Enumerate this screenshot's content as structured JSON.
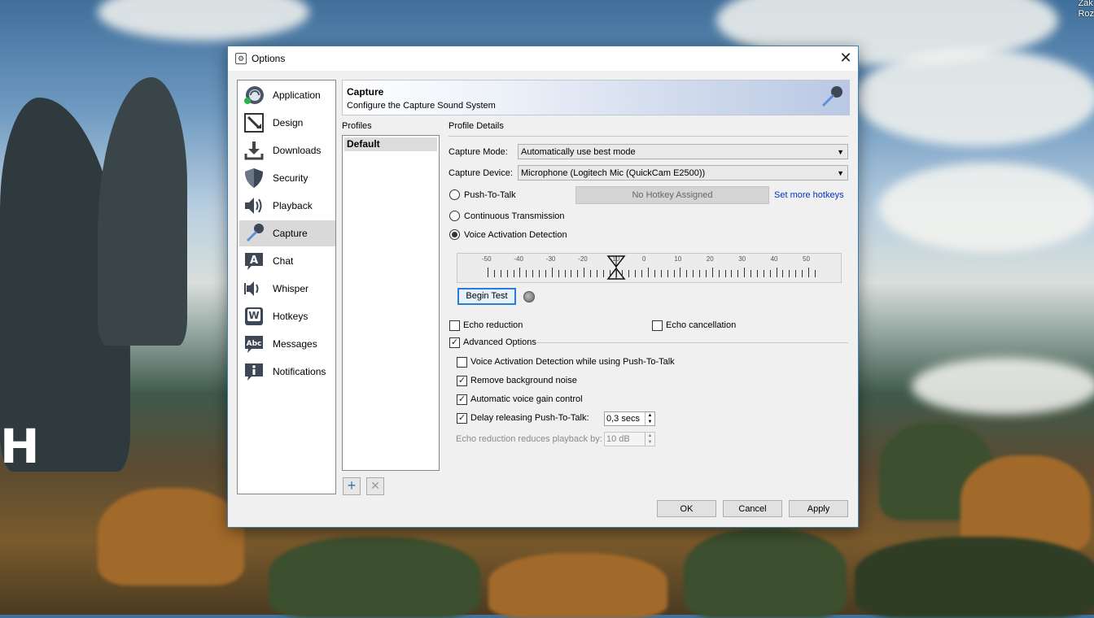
{
  "desktop": {
    "corner_text": [
      "Zak",
      "Roz"
    ],
    "left_glyph": "H"
  },
  "window": {
    "title": "Options",
    "close_glyph": "✕"
  },
  "nav": {
    "items": [
      {
        "label": "Application",
        "icon": "teamspeak-logo-icon"
      },
      {
        "label": "Design",
        "icon": "design-brush-icon"
      },
      {
        "label": "Downloads",
        "icon": "download-arrow-icon"
      },
      {
        "label": "Security",
        "icon": "shield-icon"
      },
      {
        "label": "Playback",
        "icon": "speaker-icon"
      },
      {
        "label": "Capture",
        "icon": "microphone-icon"
      },
      {
        "label": "Chat",
        "icon": "chat-bubble-icon"
      },
      {
        "label": "Whisper",
        "icon": "whisper-speaker-icon"
      },
      {
        "label": "Hotkeys",
        "icon": "keyboard-key-icon"
      },
      {
        "label": "Messages",
        "icon": "messages-bubble-icon"
      },
      {
        "label": "Notifications",
        "icon": "info-bubble-icon"
      }
    ],
    "selected": "Capture"
  },
  "banner": {
    "title": "Capture",
    "subtitle": "Configure the Capture Sound System"
  },
  "profiles": {
    "header": "Profiles",
    "items": [
      "Default"
    ],
    "add_glyph": "+",
    "remove_glyph": "✕"
  },
  "details": {
    "header": "Profile Details",
    "capture_mode_label": "Capture Mode:",
    "capture_mode_value": "Automatically use best mode",
    "capture_device_label": "Capture Device:",
    "capture_device_value": "Microphone (Logitech Mic (QuickCam E2500))",
    "push_to_talk_label": "Push-To-Talk",
    "no_hotkey": "No Hotkey Assigned",
    "set_more_hotkeys": "Set more hotkeys",
    "continuous_label": "Continuous Transmission",
    "vad_label": "Voice Activation Detection",
    "selected_mode": "Voice Activation Detection",
    "meter_labels": [
      "-50",
      "-40",
      "-30",
      "-20",
      "-10",
      "0",
      "10",
      "20",
      "30",
      "40",
      "50"
    ],
    "meter_threshold": -10,
    "begin_test": "Begin Test",
    "echo_reduction": "Echo reduction",
    "echo_cancellation": "Echo cancellation",
    "advanced_options": "Advanced Options",
    "vad_ptt": "Voice Activation Detection while using Push-To-Talk",
    "remove_noise": "Remove background noise",
    "agc": "Automatic voice gain control",
    "delay_ptt": "Delay releasing Push-To-Talk:",
    "delay_value": "0,3 secs",
    "echo_reduces": "Echo reduction reduces playback by:",
    "echo_reduces_value": "10 dB",
    "check_glyph": "✓",
    "spin_up": "▲",
    "spin_down": "▼",
    "combo_arrow": "▼"
  },
  "buttons": {
    "ok": "OK",
    "cancel": "Cancel",
    "apply": "Apply"
  }
}
